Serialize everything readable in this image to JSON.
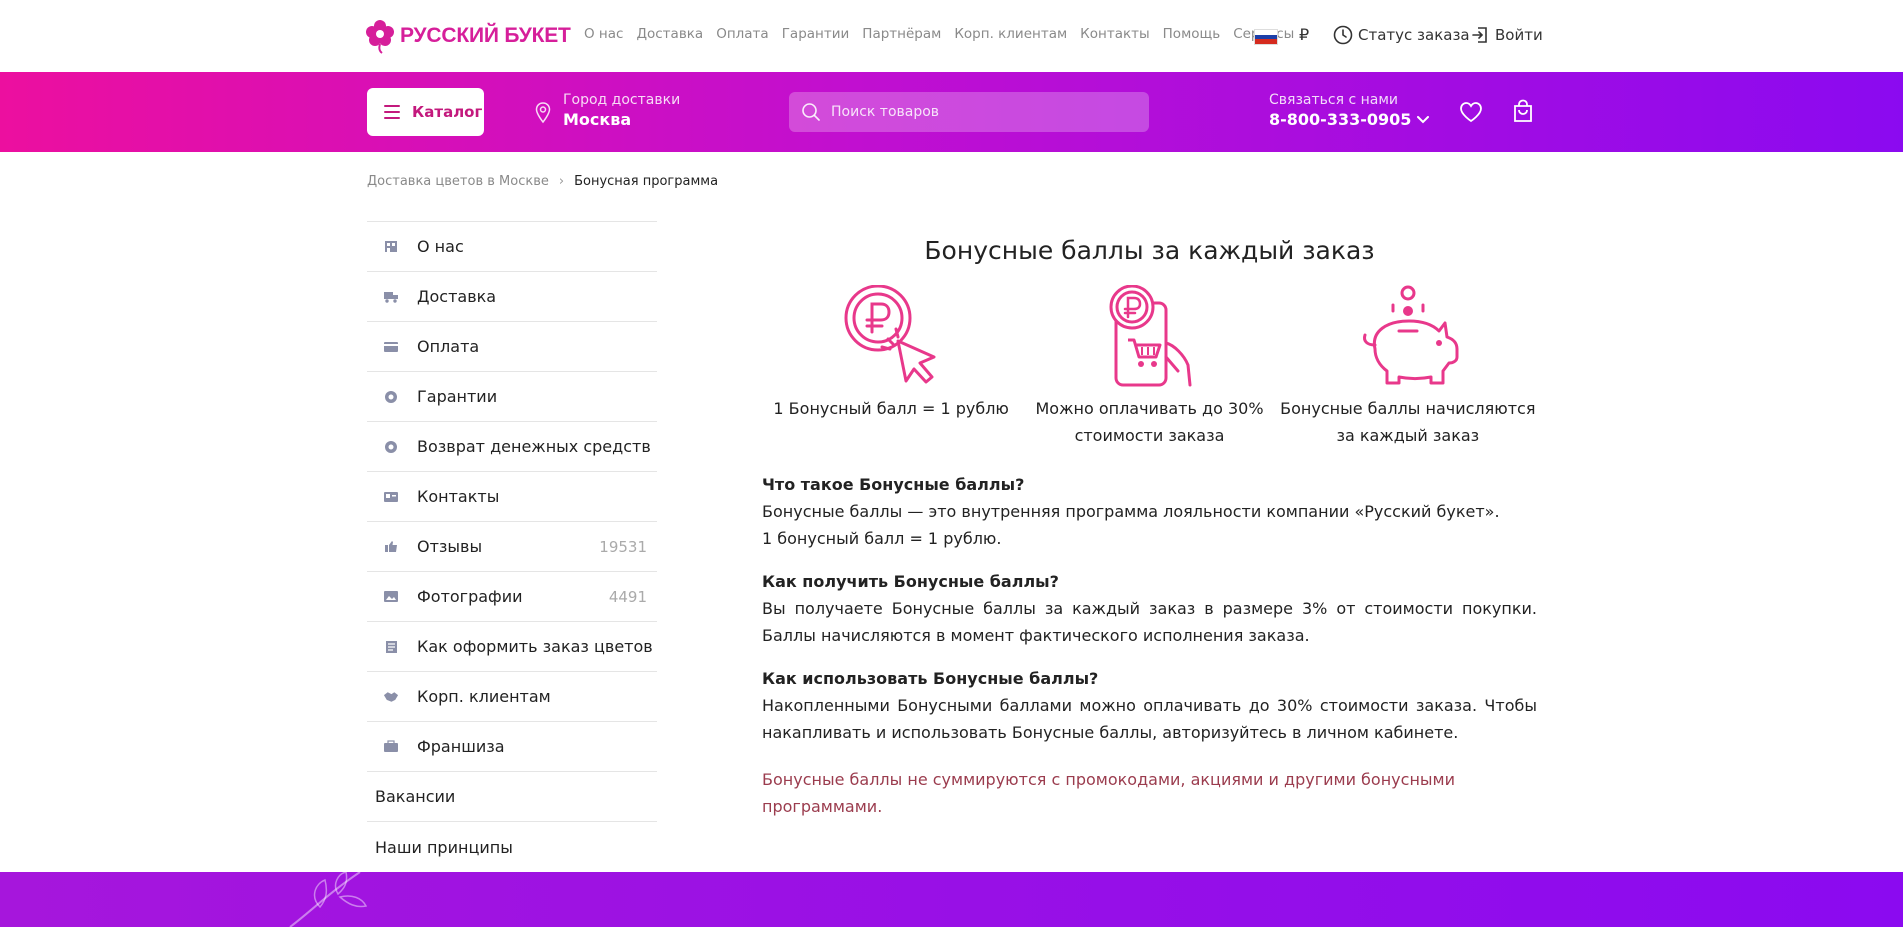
{
  "brand": {
    "name": "РУССКИЙ БУКЕТ",
    "color": "#d61f9a"
  },
  "topnav": {
    "links": [
      "О нас",
      "Доставка",
      "Оплата",
      "Гарантии",
      "Партнёрам",
      "Корп. клиентам",
      "Контакты",
      "Помощь",
      "Сервисы"
    ],
    "currency": "₽",
    "status_label": "Статус заказа",
    "login_label": "Войти"
  },
  "header": {
    "catalog_label": "Каталог",
    "city_label": "Город доставки",
    "city_value": "Москва",
    "search_placeholder": "Поиск товаров",
    "contact_label": "Связаться с нами",
    "contact_phone": "8-800-333-0905",
    "gradient": [
      "#ec0f9f",
      "#c10fd0",
      "#8b0af0"
    ]
  },
  "breadcrumb": {
    "items": [
      "Доставка цветов в Москве",
      "Бонусная программа"
    ]
  },
  "sidebar": {
    "items": [
      {
        "label": "О нас",
        "icon": "building-icon",
        "count": ""
      },
      {
        "label": "Доставка",
        "icon": "delivery-icon",
        "count": ""
      },
      {
        "label": "Оплата",
        "icon": "wallet-icon",
        "count": ""
      },
      {
        "label": "Гарантии",
        "icon": "guarantee-icon",
        "count": ""
      },
      {
        "label": "Возврат денежных средств",
        "icon": "refund-icon",
        "count": ""
      },
      {
        "label": "Контакты",
        "icon": "contact-card-icon",
        "count": ""
      },
      {
        "label": "Отзывы",
        "icon": "thumbs-up-icon",
        "count": "19531"
      },
      {
        "label": "Фотографии",
        "icon": "photo-icon",
        "count": "4491"
      },
      {
        "label": "Как оформить заказ цветов",
        "icon": "order-list-icon",
        "count": ""
      },
      {
        "label": "Корп. клиентам",
        "icon": "handshake-icon",
        "count": ""
      },
      {
        "label": "Франшиза",
        "icon": "briefcase-icon",
        "count": ""
      }
    ],
    "plain_items": [
      "Вакансии",
      "Наши принципы"
    ]
  },
  "content": {
    "title": "Бонусные баллы за каждый заказ",
    "features": [
      {
        "icon": "ruble-coin-cursor-icon",
        "text": "1 Бонусный балл = 1 рублю"
      },
      {
        "icon": "phone-cart-ruble-icon",
        "text": "Можно оплачивать до 30% стоимости заказа"
      },
      {
        "icon": "piggy-bank-icon",
        "text": "Бонусные баллы начисляются за каждый заказ"
      }
    ],
    "sections": [
      {
        "title": "Что такое Бонусные баллы?",
        "lines": [
          "Бонусные баллы — это внутренняя программа лояльности компании «Русский букет».",
          "1 бонусный балл = 1 рублю."
        ]
      },
      {
        "title": "Как получить Бонусные баллы?",
        "lines": [
          "Вы получаете Бонусные баллы за каждый заказ в размере 3% от стоимости покупки. Баллы начисляются в момент фактического исполнения заказа."
        ]
      },
      {
        "title": "Как использовать Бонусные баллы?",
        "lines": [
          "Накопленными Бонусными баллами можно оплачивать до 30% стоимости заказа. Чтобы накапливать и использовать Бонусные баллы, авторизуйтесь в личном кабинете."
        ]
      }
    ],
    "note": "Бонусные баллы не суммируются с промокодами, акциями и другими бонусными программами.",
    "accent_color": "#e8388b"
  }
}
